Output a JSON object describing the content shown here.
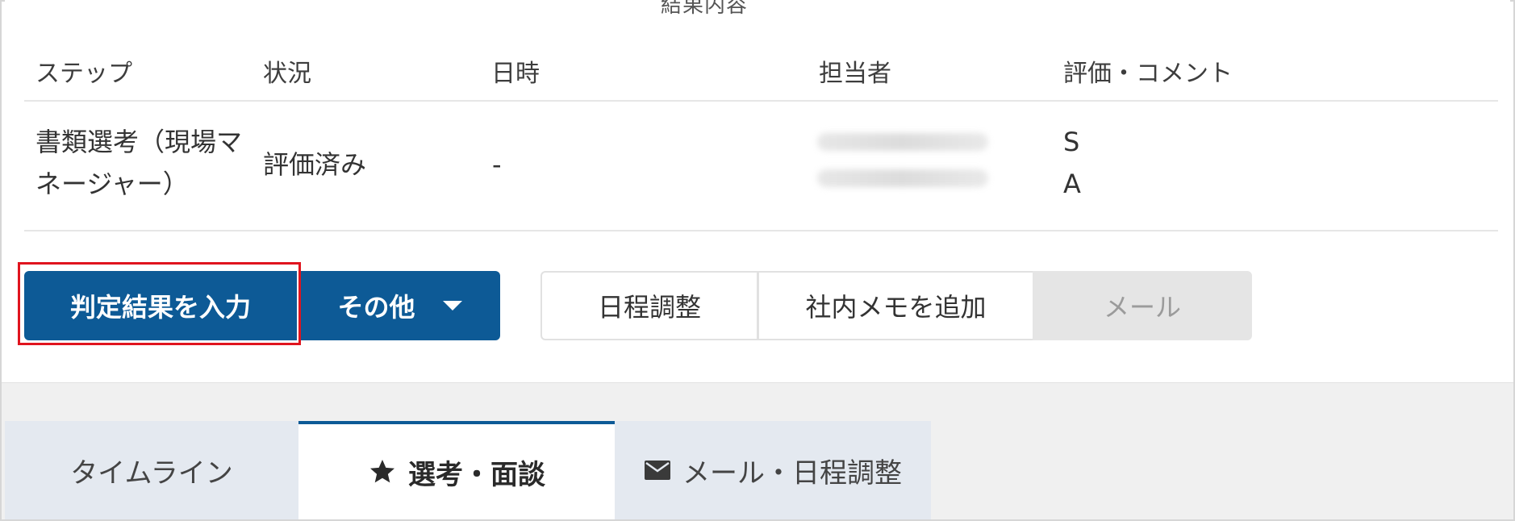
{
  "header": {
    "cut_title": "結果内容"
  },
  "table": {
    "columns": [
      "ステップ",
      "状況",
      "日時",
      "担当者",
      "評価・コメント"
    ],
    "row": {
      "step": [
        "書類選考（現場マ",
        "ネージャー）"
      ],
      "status": "評価済み",
      "datetime": "-",
      "evaluations": [
        "S",
        "A"
      ]
    }
  },
  "actions": {
    "primary_label": "判定結果を入力",
    "more_label": "その他",
    "schedule_label": "日程調整",
    "memo_label": "社内メモを追加",
    "mail_label": "メール"
  },
  "tabs": [
    {
      "label": "タイムライン",
      "icon": ""
    },
    {
      "label": "選考・面談",
      "icon": "star-icon"
    },
    {
      "label": "メール・日程調整",
      "icon": "envelope-icon"
    }
  ],
  "colors": {
    "primary": "#0d5a96",
    "highlight": "#e0141e",
    "disabled_bg": "#e5e5e5"
  }
}
